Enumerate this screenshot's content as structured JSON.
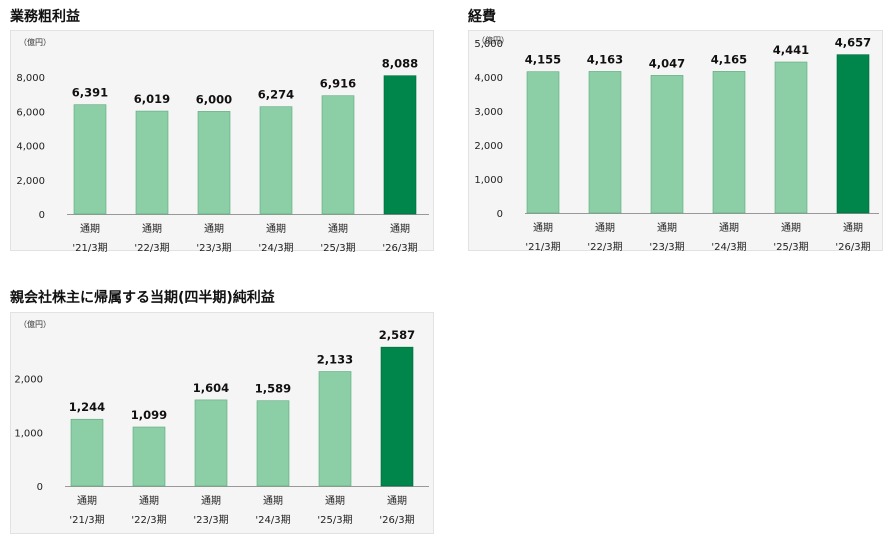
{
  "colors": {
    "bar": "#8ccfa7",
    "bar_stroke": "#5aa77b",
    "highlight": "#00854a",
    "grid": "#dcdcdc",
    "axis": "#999999"
  },
  "chart_data": [
    {
      "id": "gross-profit",
      "type": "bar",
      "title": "業務粗利益",
      "unit": "（億円）",
      "category_top": "通期",
      "categories": [
        "'21/3期",
        "'22/3期",
        "'23/3期",
        "'24/3期",
        "'25/3期",
        "'26/3期"
      ],
      "values": [
        6391,
        6019,
        6000,
        6274,
        6916,
        8088
      ],
      "value_labels": [
        "6,391",
        "6,019",
        "6,000",
        "6,274",
        "6,916",
        "8,088"
      ],
      "highlight_index": 5,
      "ylim": [
        0,
        10000
      ],
      "yticks": [
        0,
        2000,
        4000,
        6000,
        8000
      ],
      "ytick_labels": [
        "0",
        "2,000",
        "4,000",
        "6,000",
        "8,000"
      ],
      "grid": false
    },
    {
      "id": "expenses",
      "type": "bar",
      "title": "経費",
      "unit": "（億円）",
      "category_top": "通期",
      "categories": [
        "'21/3期",
        "'22/3期",
        "'23/3期",
        "'24/3期",
        "'25/3期",
        "'26/3期"
      ],
      "values": [
        4155,
        4163,
        4047,
        4165,
        4441,
        4657
      ],
      "value_labels": [
        "4,155",
        "4,163",
        "4,047",
        "4,165",
        "4,441",
        "4,657"
      ],
      "highlight_index": 5,
      "ylim": [
        0,
        5000
      ],
      "yticks": [
        0,
        1000,
        2000,
        3000,
        4000,
        5000
      ],
      "ytick_labels": [
        "0",
        "1,000",
        "2,000",
        "3,000",
        "4,000",
        "5,000"
      ],
      "grid": false
    },
    {
      "id": "net-income",
      "type": "bar",
      "title": "親会社株主に帰属する当期(四半期)純利益",
      "unit": "（億円）",
      "category_top": "通期",
      "categories": [
        "'21/3期",
        "'22/3期",
        "'23/3期",
        "'24/3期",
        "'25/3期",
        "'26/3期"
      ],
      "values": [
        1244,
        1099,
        1604,
        1589,
        2133,
        2587
      ],
      "value_labels": [
        "1,244",
        "1,099",
        "1,604",
        "1,589",
        "2,133",
        "2,587"
      ],
      "highlight_index": 5,
      "ylim": [
        0,
        3000
      ],
      "yticks": [
        0,
        1000,
        2000
      ],
      "ytick_labels": [
        "0",
        "1,000",
        "2,000"
      ],
      "grid": false
    }
  ]
}
